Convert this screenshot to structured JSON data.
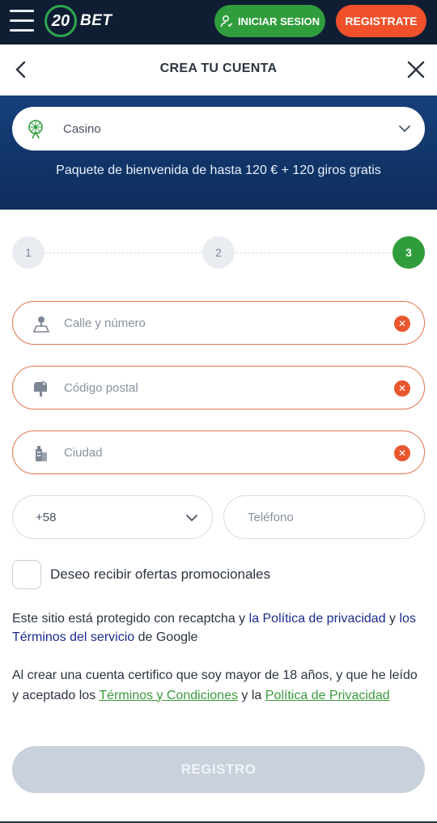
{
  "topbar": {
    "logo_number": "20",
    "logo_text": "BET",
    "login_label": "INICIAR SESION",
    "register_label": "REGISTRATE",
    "colors": {
      "bg": "#0f1e33",
      "login": "#2f9d3c",
      "register": "#f0512a"
    }
  },
  "header": {
    "title": "CREA TU CUENTA"
  },
  "bonus": {
    "selected": "Casino",
    "icon": "ferris-wheel-icon",
    "description": "Paquete de bienvenida de hasta 120 € + 120 giros gratis"
  },
  "stepper": {
    "steps": [
      "1",
      "2",
      "3"
    ],
    "active_step": 3
  },
  "form": {
    "street": {
      "placeholder": "Calle y número",
      "icon": "map-pin-icon"
    },
    "postal": {
      "placeholder": "Código postal",
      "icon": "mailbox-icon"
    },
    "city": {
      "placeholder": "Ciudad",
      "icon": "building-icon"
    },
    "phone_code": "+58",
    "phone_placeholder": "Teléfono",
    "promo_label": "Deseo recibir ofertas promocionales"
  },
  "legal": {
    "recaptcha_prefix": "Este sitio está protegido con recaptcha y ",
    "privacy_google": "la Política de privacidad",
    "and": " y ",
    "terms_google": "los Términos del servicio",
    "recaptcha_suffix": " de Google",
    "age_prefix": "Al crear una cuenta certifico que soy mayor de 18 años, y que he leído y aceptado los ",
    "terms_link": "Términos y Condiciones",
    "age_mid": " y la ",
    "privacy_link": "Política de Privacidad"
  },
  "submit_label": "REGISTRO"
}
